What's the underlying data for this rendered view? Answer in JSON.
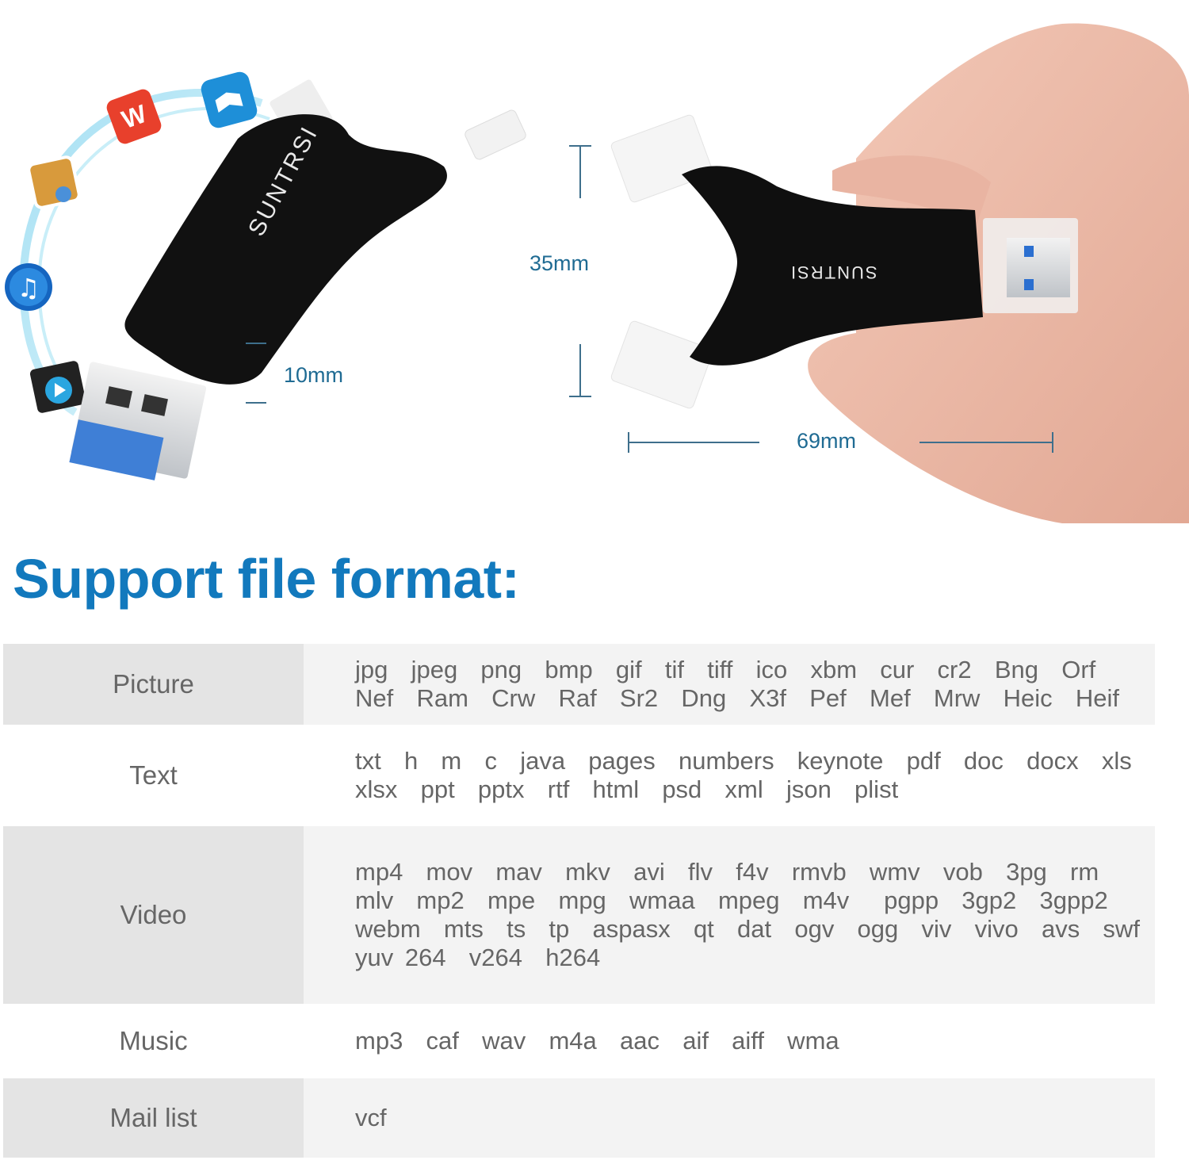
{
  "product": {
    "brand": "SUNTRSI",
    "dimensions": {
      "thickness": "10mm",
      "height": "35mm",
      "length": "69mm"
    },
    "app_icons": [
      "wps-office-icon",
      "books-icon",
      "photos-icon",
      "music-icon",
      "video-player-icon"
    ]
  },
  "section": {
    "title": "Support file format:"
  },
  "formats": [
    {
      "category": "Picture",
      "lines": [
        "jpg  jpeg  png  bmp  gif  tif  tiff  ico  xbm  cur  cr2  Bng  Orf",
        "Nef  Ram  Crw  Raf  Sr2  Dng  X3f  Pef  Mef  Mrw  Heic  Heif"
      ]
    },
    {
      "category": "Text",
      "lines": [
        "txt  h  m  c  java  pages  numbers  keynote  pdf  doc  docx  xls",
        "xlsx  ppt  pptx  rtf  html  psd  xml  json  plist"
      ]
    },
    {
      "category": "Video",
      "lines": [
        "mp4  mov  mav  mkv  avi  flv  f4v  rmvb  wmv  vob  3pg  rm",
        "mlv  mp2  mpe  mpg  wmaa  mpeg  m4v   pgpp  3gp2  3gpp2",
        "webm  mts  ts  tp  aspasx  qt  dat  ogv  ogg  viv  vivo  avs  swf",
        "yuv 264  v264  h264"
      ]
    },
    {
      "category": "Music",
      "lines": [
        "mp3  caf  wav  m4a  aac  aif  aiff  wma"
      ]
    },
    {
      "category": "Mail list",
      "lines": [
        "vcf"
      ]
    }
  ]
}
